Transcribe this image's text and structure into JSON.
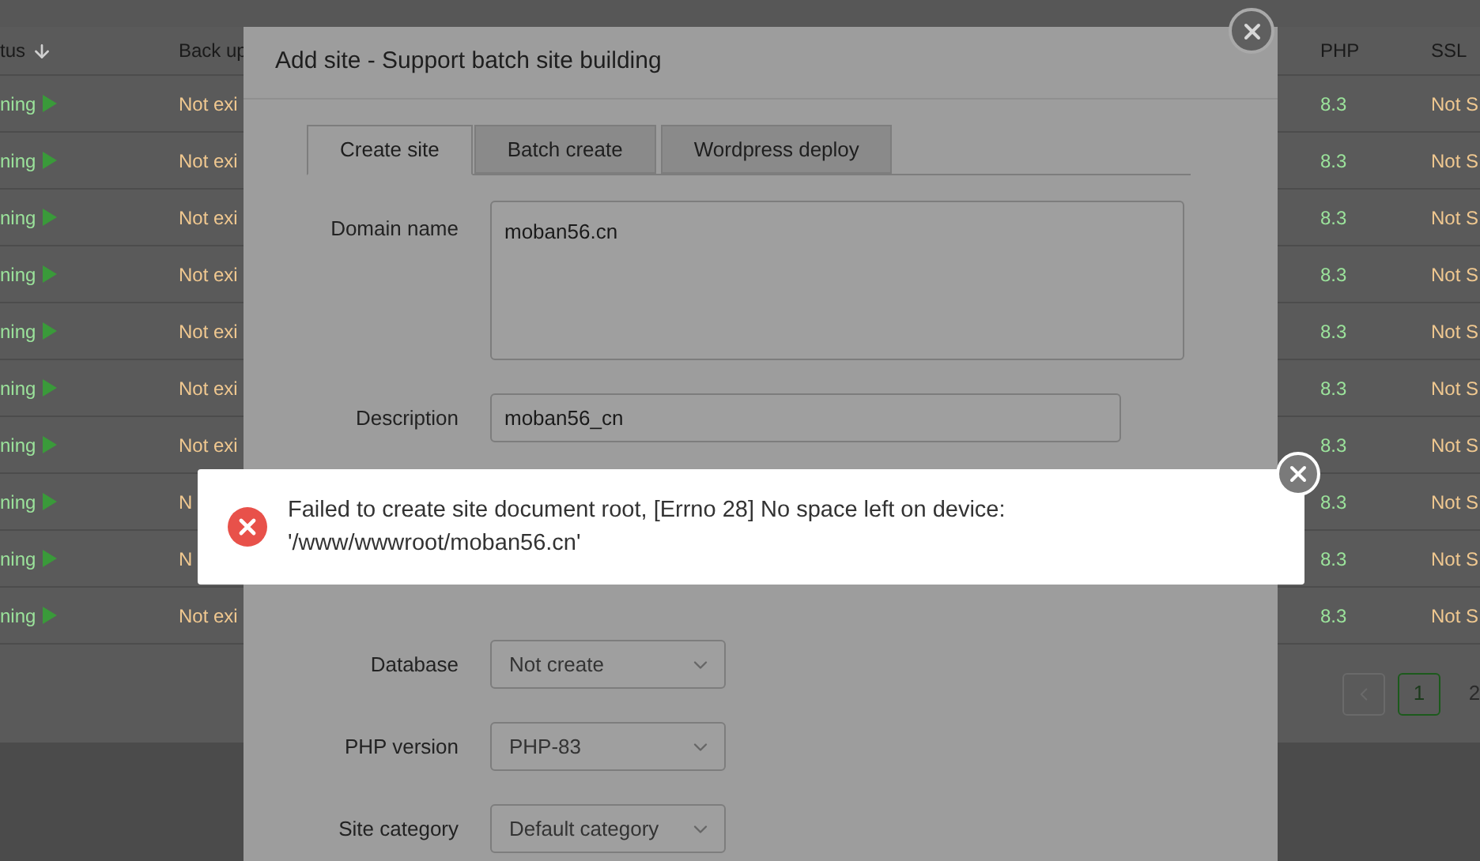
{
  "background_table": {
    "columns": [
      {
        "label": "tus",
        "sorted": true
      },
      {
        "label": "Back up"
      },
      {
        "label": "PHP"
      },
      {
        "label": "SSL"
      }
    ],
    "rows": [
      {
        "status": "ning",
        "backup": "Not exi",
        "php": "8.3",
        "ssl": "Not S"
      },
      {
        "status": "ning",
        "backup": "Not exi",
        "php": "8.3",
        "ssl": "Not S"
      },
      {
        "status": "ning",
        "backup": "Not exi",
        "php": "8.3",
        "ssl": "Not S"
      },
      {
        "status": "ning",
        "backup": "Not exi",
        "php": "8.3",
        "ssl": "Not S"
      },
      {
        "status": "ning",
        "backup": "Not exi",
        "php": "8.3",
        "ssl": "Not S"
      },
      {
        "status": "ning",
        "backup": "Not exi",
        "php": "8.3",
        "ssl": "Not S"
      },
      {
        "status": "ning",
        "backup": "Not exi",
        "php": "8.3",
        "ssl": "Not S"
      },
      {
        "status": "ning",
        "backup": "N",
        "php": "8.3",
        "ssl": "Not S"
      },
      {
        "status": "ning",
        "backup": "N",
        "php": "8.3",
        "ssl": "Not S"
      },
      {
        "status": "ning",
        "backup": "Not exi",
        "php": "8.3",
        "ssl": "Not S"
      }
    ],
    "pagination": {
      "pages": [
        {
          "label": "1",
          "selected": true
        },
        {
          "label": "2",
          "selected": false
        }
      ]
    }
  },
  "dialog": {
    "title": "Add site - Support batch site building",
    "tabs": [
      {
        "label": "Create site",
        "selected": true
      },
      {
        "label": "Batch create",
        "selected": false
      },
      {
        "label": "Wordpress deploy",
        "selected": false
      }
    ],
    "fields": [
      {
        "kind": "textarea",
        "label": "Domain name",
        "value": "moban56.cn"
      },
      {
        "kind": "input",
        "label": "Description",
        "value": "moban56_cn"
      },
      {
        "kind": "hidden"
      },
      {
        "kind": "select",
        "label": "Database",
        "value": "Not create"
      },
      {
        "kind": "select",
        "label": "PHP version",
        "value": "PHP-83"
      },
      {
        "kind": "select",
        "label": "Site category",
        "value": "Default category"
      }
    ]
  },
  "toast": {
    "kind": "error",
    "message": "Failed to create site document root, [Errno 28] No space left on device: '/www/wwwroot/moban56.cn'"
  }
}
